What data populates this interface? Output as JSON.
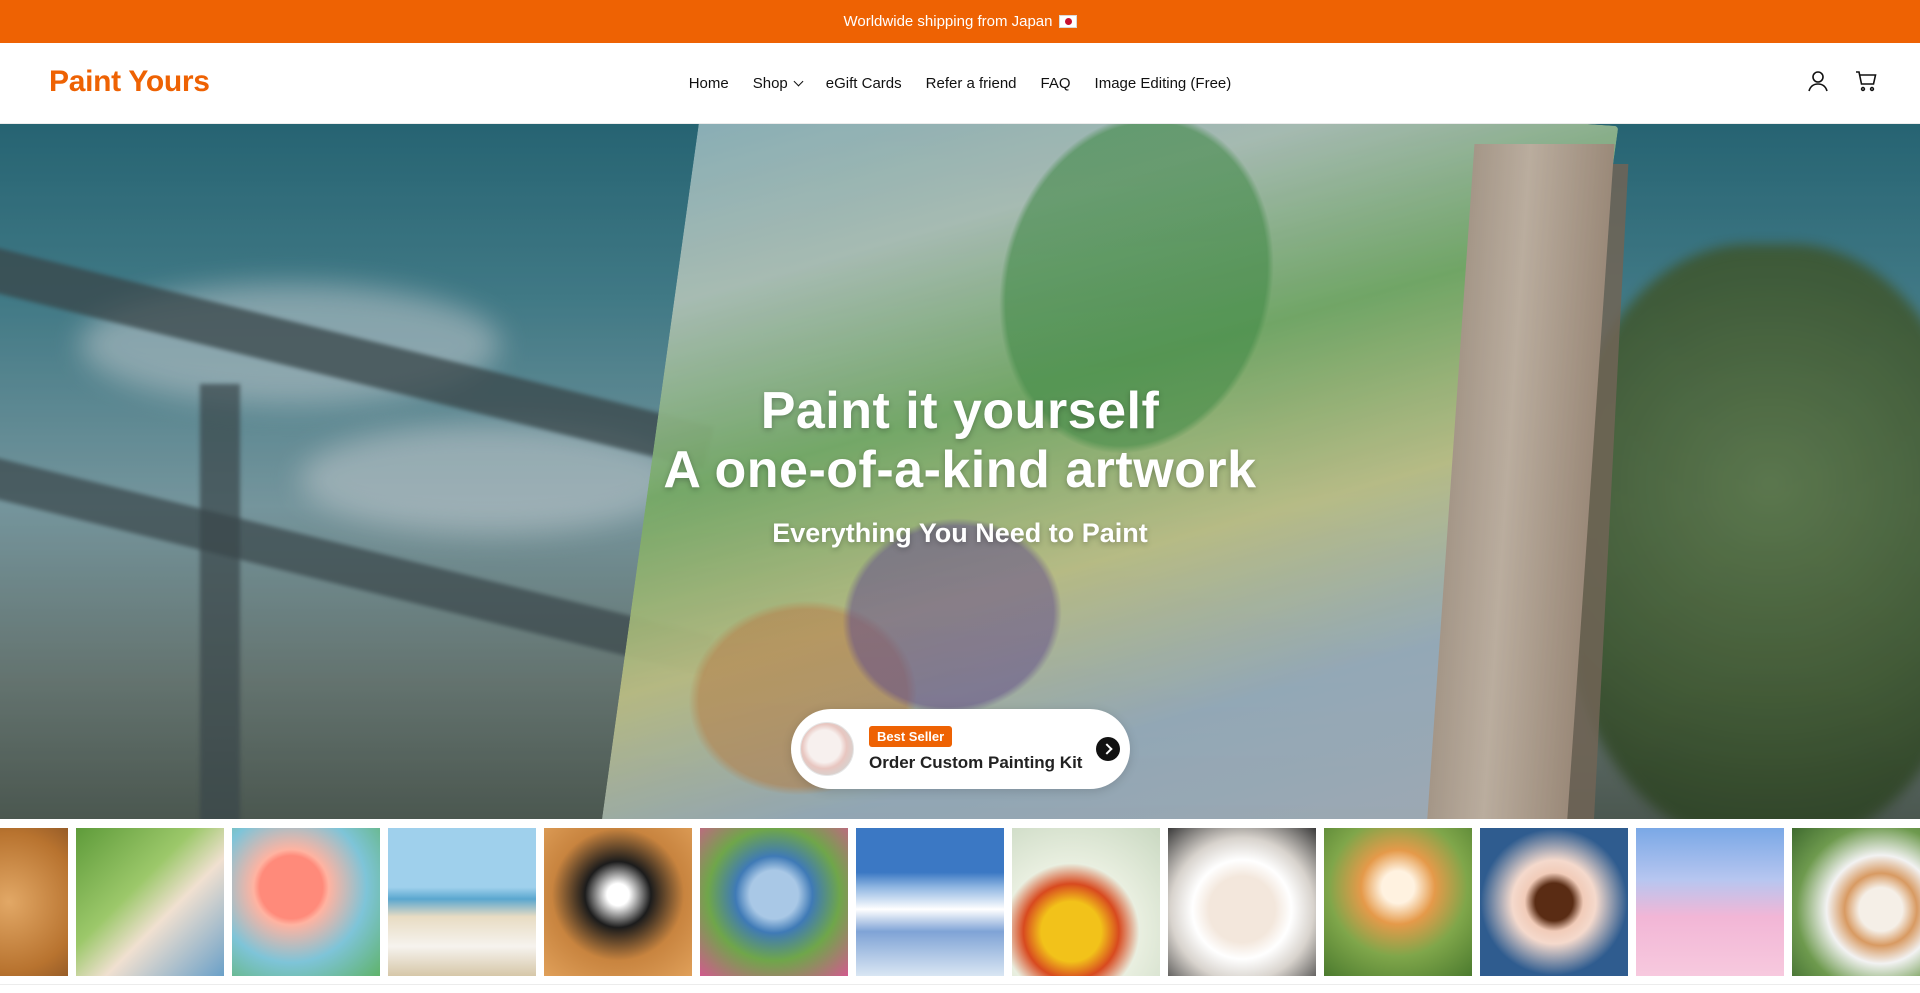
{
  "announcement": {
    "text": "Worldwide shipping from Japan",
    "flag_icon": "japan-flag-icon"
  },
  "header": {
    "logo": "Paint Yours",
    "nav": [
      {
        "label": "Home"
      },
      {
        "label": "Shop"
      },
      {
        "label": "eGift Cards"
      },
      {
        "label": "Refer a friend"
      },
      {
        "label": "FAQ"
      },
      {
        "label": "Image Editing (Free)"
      }
    ],
    "icons": [
      "account-icon",
      "cart-icon"
    ]
  },
  "hero": {
    "title_line1": "Paint it yourself",
    "title_line2": "A one-of-a-kind artwork",
    "subtitle": "Everything You Need to Paint",
    "promo": {
      "badge": "Best Seller",
      "label": "Order Custom Painting Kit"
    }
  },
  "gallery": [
    {
      "name": "golden-retriever-painting"
    },
    {
      "name": "child-and-mother-painting"
    },
    {
      "name": "red-poppies-painting"
    },
    {
      "name": "beach-wedding-couple-painting"
    },
    {
      "name": "border-collie-painting"
    },
    {
      "name": "elderly-gardener-painting"
    },
    {
      "name": "mount-fuji-painting"
    },
    {
      "name": "woman-with-flowers-painting"
    },
    {
      "name": "wedding-hands-painting"
    },
    {
      "name": "corgi-painting"
    },
    {
      "name": "coffee-cup-painting"
    },
    {
      "name": "pink-clouds-painting"
    },
    {
      "name": "cat-with-daisies-painting"
    }
  ],
  "colors": {
    "brand": "#ee6203",
    "text": "#111111"
  }
}
